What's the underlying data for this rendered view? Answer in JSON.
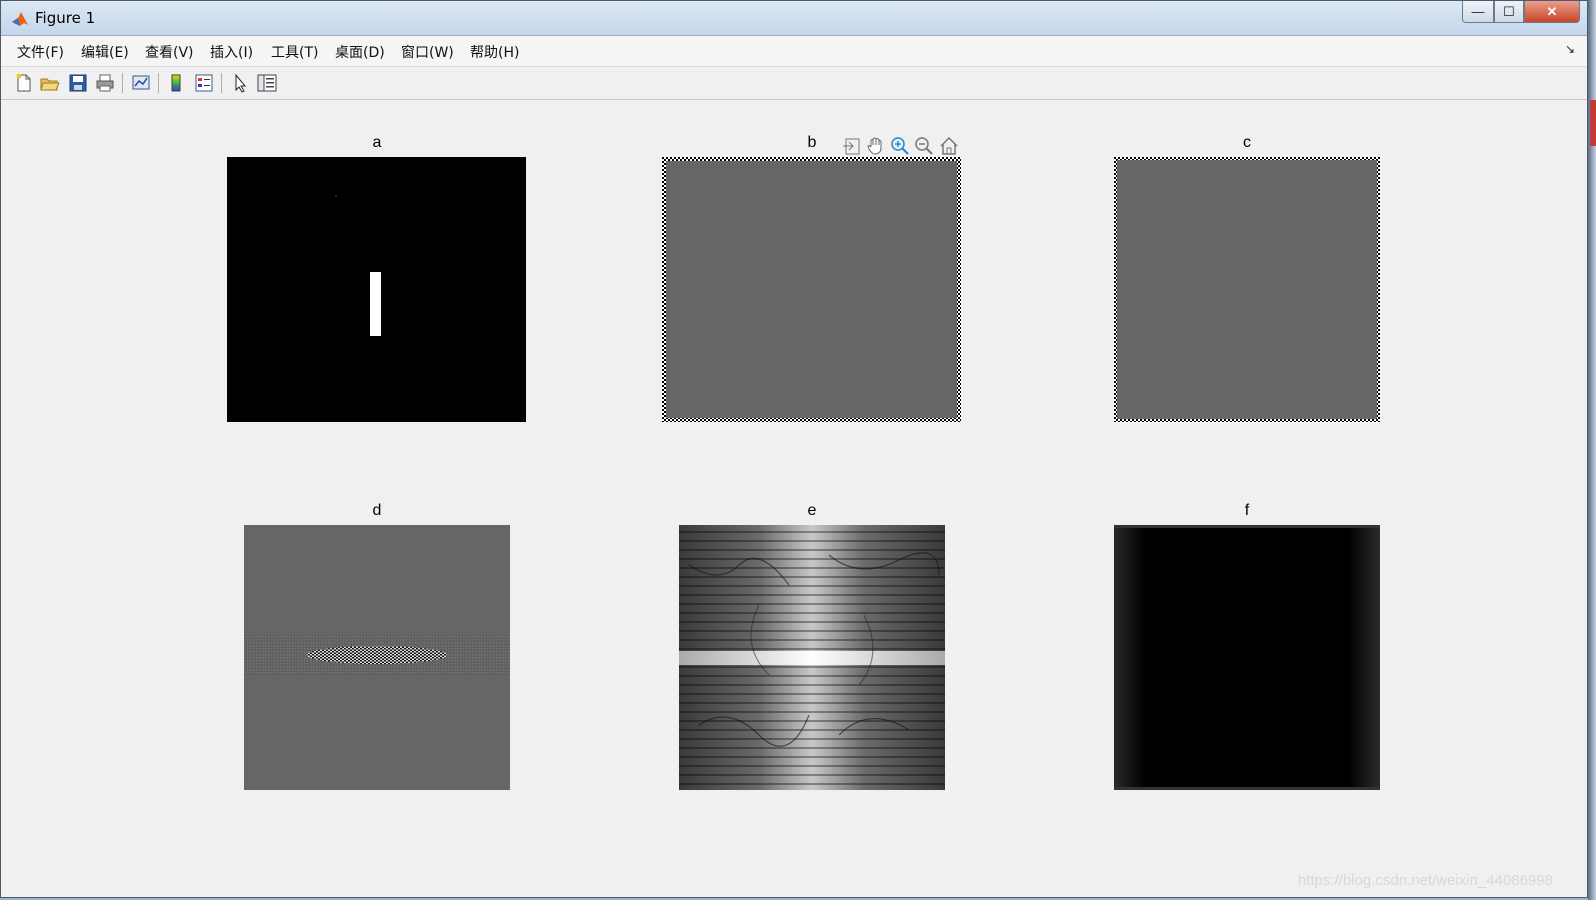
{
  "window": {
    "title": "Figure 1",
    "controls": {
      "minimize": "—",
      "maximize": "☐",
      "close": "✕"
    }
  },
  "menu": {
    "items": [
      "文件(F)",
      "编辑(E)",
      "查看(V)",
      "插入(I)",
      "工具(T)",
      "桌面(D)",
      "窗口(W)",
      "帮助(H)"
    ],
    "dock_glyph": "↘"
  },
  "toolbar": {
    "buttons": [
      "new-figure-icon",
      "open-file-icon",
      "save-icon",
      "print-icon",
      "link-plot-icon",
      "colorbar-icon",
      "legend-icon",
      "pointer-icon",
      "property-inspector-icon"
    ]
  },
  "axes_toolbar": {
    "buttons": [
      "export-icon",
      "pan-icon",
      "zoom-in-icon",
      "zoom-out-icon",
      "home-icon"
    ]
  },
  "figure": {
    "subplots": [
      {
        "id": "a",
        "title": "a",
        "content": "black image with white vertical bar"
      },
      {
        "id": "b",
        "title": "b",
        "content": "gray image with checkerboard edges"
      },
      {
        "id": "c",
        "title": "c",
        "content": "gray image with checkerboard edges"
      },
      {
        "id": "d",
        "title": "d",
        "content": "gray image with oscillating pattern at center"
      },
      {
        "id": "e",
        "title": "e",
        "content": "grayscale spectrum with horizontal bands"
      },
      {
        "id": "f",
        "title": "f",
        "content": "near-black image"
      }
    ]
  },
  "watermark": "https://blog.csdn.net/weixin_44086998",
  "colors": {
    "figure_bg": "#f0f0f0",
    "gray": "#666666"
  }
}
